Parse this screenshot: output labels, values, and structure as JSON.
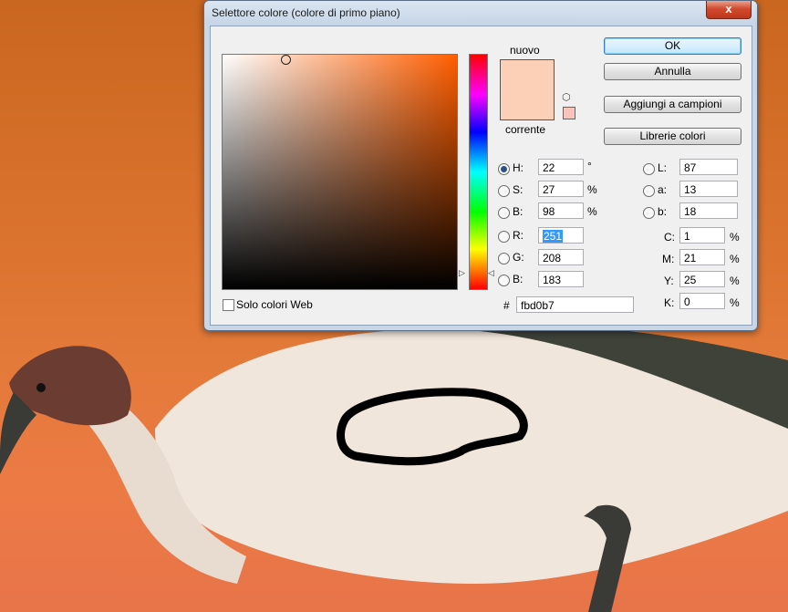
{
  "dialog": {
    "title": "Selettore colore (colore di primo piano)",
    "close_glyph": "x"
  },
  "swatch": {
    "new_label": "nuovo",
    "current_label": "corrente",
    "new_color": "#fcd0b6",
    "current_color": "#fcd0b6"
  },
  "buttons": {
    "ok": "OK",
    "cancel": "Annulla",
    "add_to_swatches": "Aggiungi a campioni",
    "color_libraries": "Librerie colori"
  },
  "hsb": {
    "h_label": "H:",
    "h_value": "22",
    "h_unit": "°",
    "s_label": "S:",
    "s_value": "27",
    "s_unit": "%",
    "b_label": "B:",
    "b_value": "98",
    "b_unit": "%"
  },
  "rgb": {
    "r_label": "R:",
    "r_value": "251",
    "g_label": "G:",
    "g_value": "208",
    "b_label": "B:",
    "b_value": "183"
  },
  "lab": {
    "l_label": "L:",
    "l_value": "87",
    "a_label": "a:",
    "a_value": "13",
    "b_label": "b:",
    "b_value": "18"
  },
  "cmyk": {
    "c_label": "C:",
    "c_value": "1",
    "m_label": "M:",
    "m_value": "21",
    "y_label": "Y:",
    "y_value": "25",
    "k_label": "K:",
    "k_value": "0",
    "unit": "%"
  },
  "hex": {
    "label": "#",
    "value": "fbd0b7"
  },
  "web_only": {
    "label": "Solo colori Web",
    "checked": false
  },
  "icons": [
    "close-icon",
    "cube-icon",
    "radio-icon",
    "checkbox-icon"
  ]
}
